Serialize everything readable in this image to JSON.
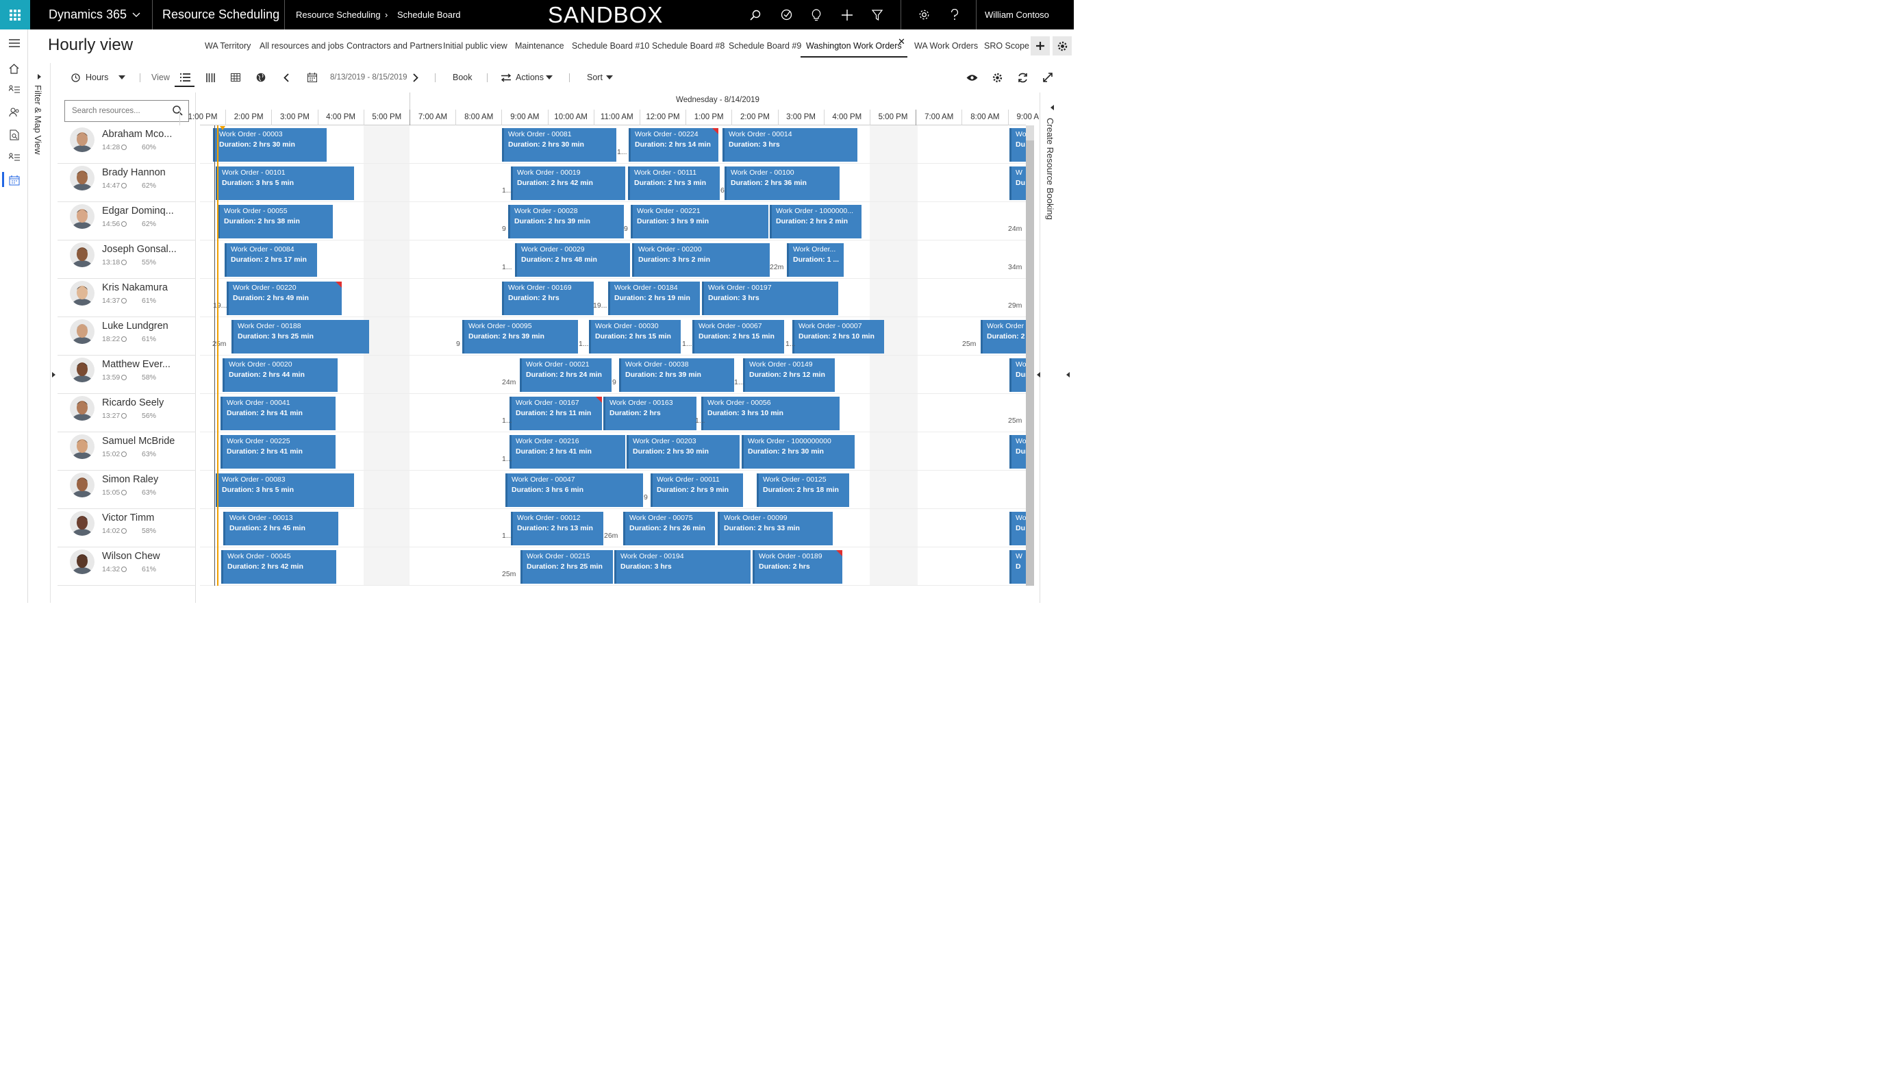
{
  "topbar": {
    "app_name": "Dynamics 365",
    "module": "Resource Scheduling",
    "breadcrumb": [
      "Resource Scheduling",
      "Schedule Board"
    ],
    "environment": "SANDBOX",
    "user": "William Contoso"
  },
  "page": {
    "title": "Hourly view"
  },
  "tabs": [
    "WA Territory",
    "All resources and jobs",
    "Contractors and Partners",
    "Initial public view",
    "Maintenance",
    "Schedule Board #10",
    "Schedule Board #8",
    "Schedule Board #9",
    "Washington Work Orders",
    "WA Work Orders",
    "SRO Scope"
  ],
  "active_tab": "Washington Work Orders",
  "toolbar": {
    "hours_label": "Hours",
    "view_label": "View",
    "date_range": "8/13/2019 - 8/15/2019",
    "book_label": "Book",
    "actions_label": "Actions",
    "sort_label": "Sort"
  },
  "side_panels": {
    "left": "Filter & Map View",
    "right": "Create Resource Booking"
  },
  "search": {
    "placeholder": "Search resources..."
  },
  "timeline": {
    "date_header": "Wednesday - 8/14/2019",
    "hours": [
      "1:00 PM",
      "2:00 PM",
      "3:00 PM",
      "4:00 PM",
      "5:00 PM",
      "7:00 AM",
      "8:00 AM",
      "9:00 AM",
      "10:00 AM",
      "11:00 AM",
      "12:00 PM",
      "1:00 PM",
      "2:00 PM",
      "3:00 PM",
      "4:00 PM",
      "5:00 PM",
      "7:00 AM",
      "8:00 AM",
      "9:00 AM"
    ]
  },
  "resources": [
    {
      "name": "Abraham Mco...",
      "time": "14:28",
      "util": "60%"
    },
    {
      "name": "Brady Hannon",
      "time": "14:47",
      "util": "62%"
    },
    {
      "name": "Edgar Dominq...",
      "time": "14:56",
      "util": "62%"
    },
    {
      "name": "Joseph Gonsal...",
      "time": "13:18",
      "util": "55%"
    },
    {
      "name": "Kris Nakamura",
      "time": "14:37",
      "util": "61%"
    },
    {
      "name": "Luke Lundgren",
      "time": "18:22",
      "util": "61%"
    },
    {
      "name": "Matthew Ever...",
      "time": "13:59",
      "util": "58%"
    },
    {
      "name": "Ricardo Seely",
      "time": "13:27",
      "util": "56%"
    },
    {
      "name": "Samuel McBride",
      "time": "15:02",
      "util": "63%"
    },
    {
      "name": "Simon Raley",
      "time": "15:05",
      "util": "63%"
    },
    {
      "name": "Victor Timm",
      "time": "14:02",
      "util": "58%"
    },
    {
      "name": "Wilson Chew",
      "time": "14:32",
      "util": "61%"
    }
  ],
  "bookings": [
    [
      [
        "Work Order - 00003",
        "Duration: 2 hrs 30 min"
      ],
      [
        "Work Order - 00081",
        "Duration: 2 hrs 30 min"
      ],
      [
        "Work Order - 00224",
        "Duration: 2 hrs 14 min"
      ],
      [
        "Work Order - 00014",
        "Duration: 3 hrs"
      ],
      [
        "Wo",
        "Du"
      ]
    ],
    [
      [
        "Work Order - 00101",
        "Duration: 3 hrs 5 min"
      ],
      [
        "Work Order - 00019",
        "Duration: 2 hrs 42 min"
      ],
      [
        "Work Order - 00111",
        "Duration: 2 hrs 3 min"
      ],
      [
        "Work Order - 00100",
        "Duration: 2 hrs 36 min"
      ],
      [
        "W",
        "Du"
      ]
    ],
    [
      [
        "Work Order - 00055",
        "Duration: 2 hrs 38 min"
      ],
      [
        "Work Order - 00028",
        "Duration: 2 hrs 39 min"
      ],
      [
        "Work Order - 00221",
        "Duration: 3 hrs 9 min"
      ],
      [
        "Work Order - 1000000...",
        "Duration: 2 hrs 2 min"
      ]
    ],
    [
      [
        "Work Order - 00084",
        "Duration: 2 hrs 17 min"
      ],
      [
        "Work Order - 00029",
        "Duration: 2 hrs 48 min"
      ],
      [
        "Work Order - 00200",
        "Duration: 3 hrs 2 min"
      ],
      [
        "Work Order...",
        "Duration: 1 ..."
      ]
    ],
    [
      [
        "Work Order - 00220",
        "Duration: 2 hrs 49 min"
      ],
      [
        "Work Order - 00169",
        "Duration: 2 hrs"
      ],
      [
        "Work Order - 00184",
        "Duration: 2 hrs 19 min"
      ],
      [
        "Work Order - 00197",
        "Duration: 3 hrs"
      ]
    ],
    [
      [
        "Work Order - 00188",
        "Duration: 3 hrs 25 min"
      ],
      [
        "Work Order - 00095",
        "Duration: 2 hrs 39 min"
      ],
      [
        "Work Order - 00030",
        "Duration: 2 hrs 15 min"
      ],
      [
        "Work Order - 00067",
        "Duration: 2 hrs 15 min"
      ],
      [
        "Work Order - 00007",
        "Duration: 2 hrs 10 min"
      ],
      [
        "Work Order",
        "Duration: 2 h"
      ]
    ],
    [
      [
        "Work Order - 00020",
        "Duration: 2 hrs 44 min"
      ],
      [
        "Work Order - 00021",
        "Duration: 2 hrs 24 min"
      ],
      [
        "Work Order - 00038",
        "Duration: 2 hrs 39 min"
      ],
      [
        "Work Order - 00149",
        "Duration: 2 hrs 12 min"
      ],
      [
        "Wo",
        "Dur"
      ]
    ],
    [
      [
        "Work Order - 00041",
        "Duration: 2 hrs 41 min"
      ],
      [
        "Work Order - 00167",
        "Duration: 2 hrs 11 min"
      ],
      [
        "Work Order - 00163",
        "Duration: 2 hrs"
      ],
      [
        "Work Order - 00056",
        "Duration: 3 hrs 10 min"
      ]
    ],
    [
      [
        "Work Order - 00225",
        "Duration: 2 hrs 41 min"
      ],
      [
        "Work Order - 00216",
        "Duration: 2 hrs 41 min"
      ],
      [
        "Work Order - 00203",
        "Duration: 2 hrs 30 min"
      ],
      [
        "Work Order - 1000000000",
        "Duration: 2 hrs 30 min"
      ],
      [
        "Wo",
        "Dur"
      ]
    ],
    [
      [
        "Work Order - 00083",
        "Duration: 3 hrs 5 min"
      ],
      [
        "Work Order - 00047",
        "Duration: 3 hrs 6 min"
      ],
      [
        "Work Order - 00011",
        "Duration: 2 hrs 9 min"
      ],
      [
        "Work Order - 00125",
        "Duration: 2 hrs 18 min"
      ]
    ],
    [
      [
        "Work Order - 00013",
        "Duration: 2 hrs 45 min"
      ],
      [
        "Work Order - 00012",
        "Duration: 2 hrs 13 min"
      ],
      [
        "Work Order - 00075",
        "Duration: 2 hrs 26 min"
      ],
      [
        "Work Order - 00099",
        "Duration: 2 hrs 33 min"
      ],
      [
        "Wo",
        "Du"
      ]
    ],
    [
      [
        "Work Order - 00045",
        "Duration: 2 hrs 42 min"
      ],
      [
        "Work Order - 00215",
        "Duration: 2 hrs 25 min"
      ],
      [
        "Work Order - 00194",
        "Duration: 3 hrs"
      ],
      [
        "Work Order - 00189",
        "Duration: 2 hrs"
      ],
      [
        "W",
        "D"
      ]
    ]
  ],
  "travel_labels": [
    [
      "1..."
    ],
    [
      "1...",
      "6"
    ],
    [
      "9",
      "9",
      "24m"
    ],
    [
      "1...",
      "22m",
      "34m"
    ],
    [
      "19...",
      "19...",
      "29m"
    ],
    [
      "25m",
      "9",
      "1...",
      "1...",
      "1...",
      "25m"
    ],
    [
      "24m",
      "9",
      "1..."
    ],
    [
      "1...",
      "1...",
      "25m"
    ],
    [
      "1..."
    ],
    [
      "9"
    ],
    [
      "1...",
      "26m"
    ],
    [
      "25m"
    ]
  ]
}
